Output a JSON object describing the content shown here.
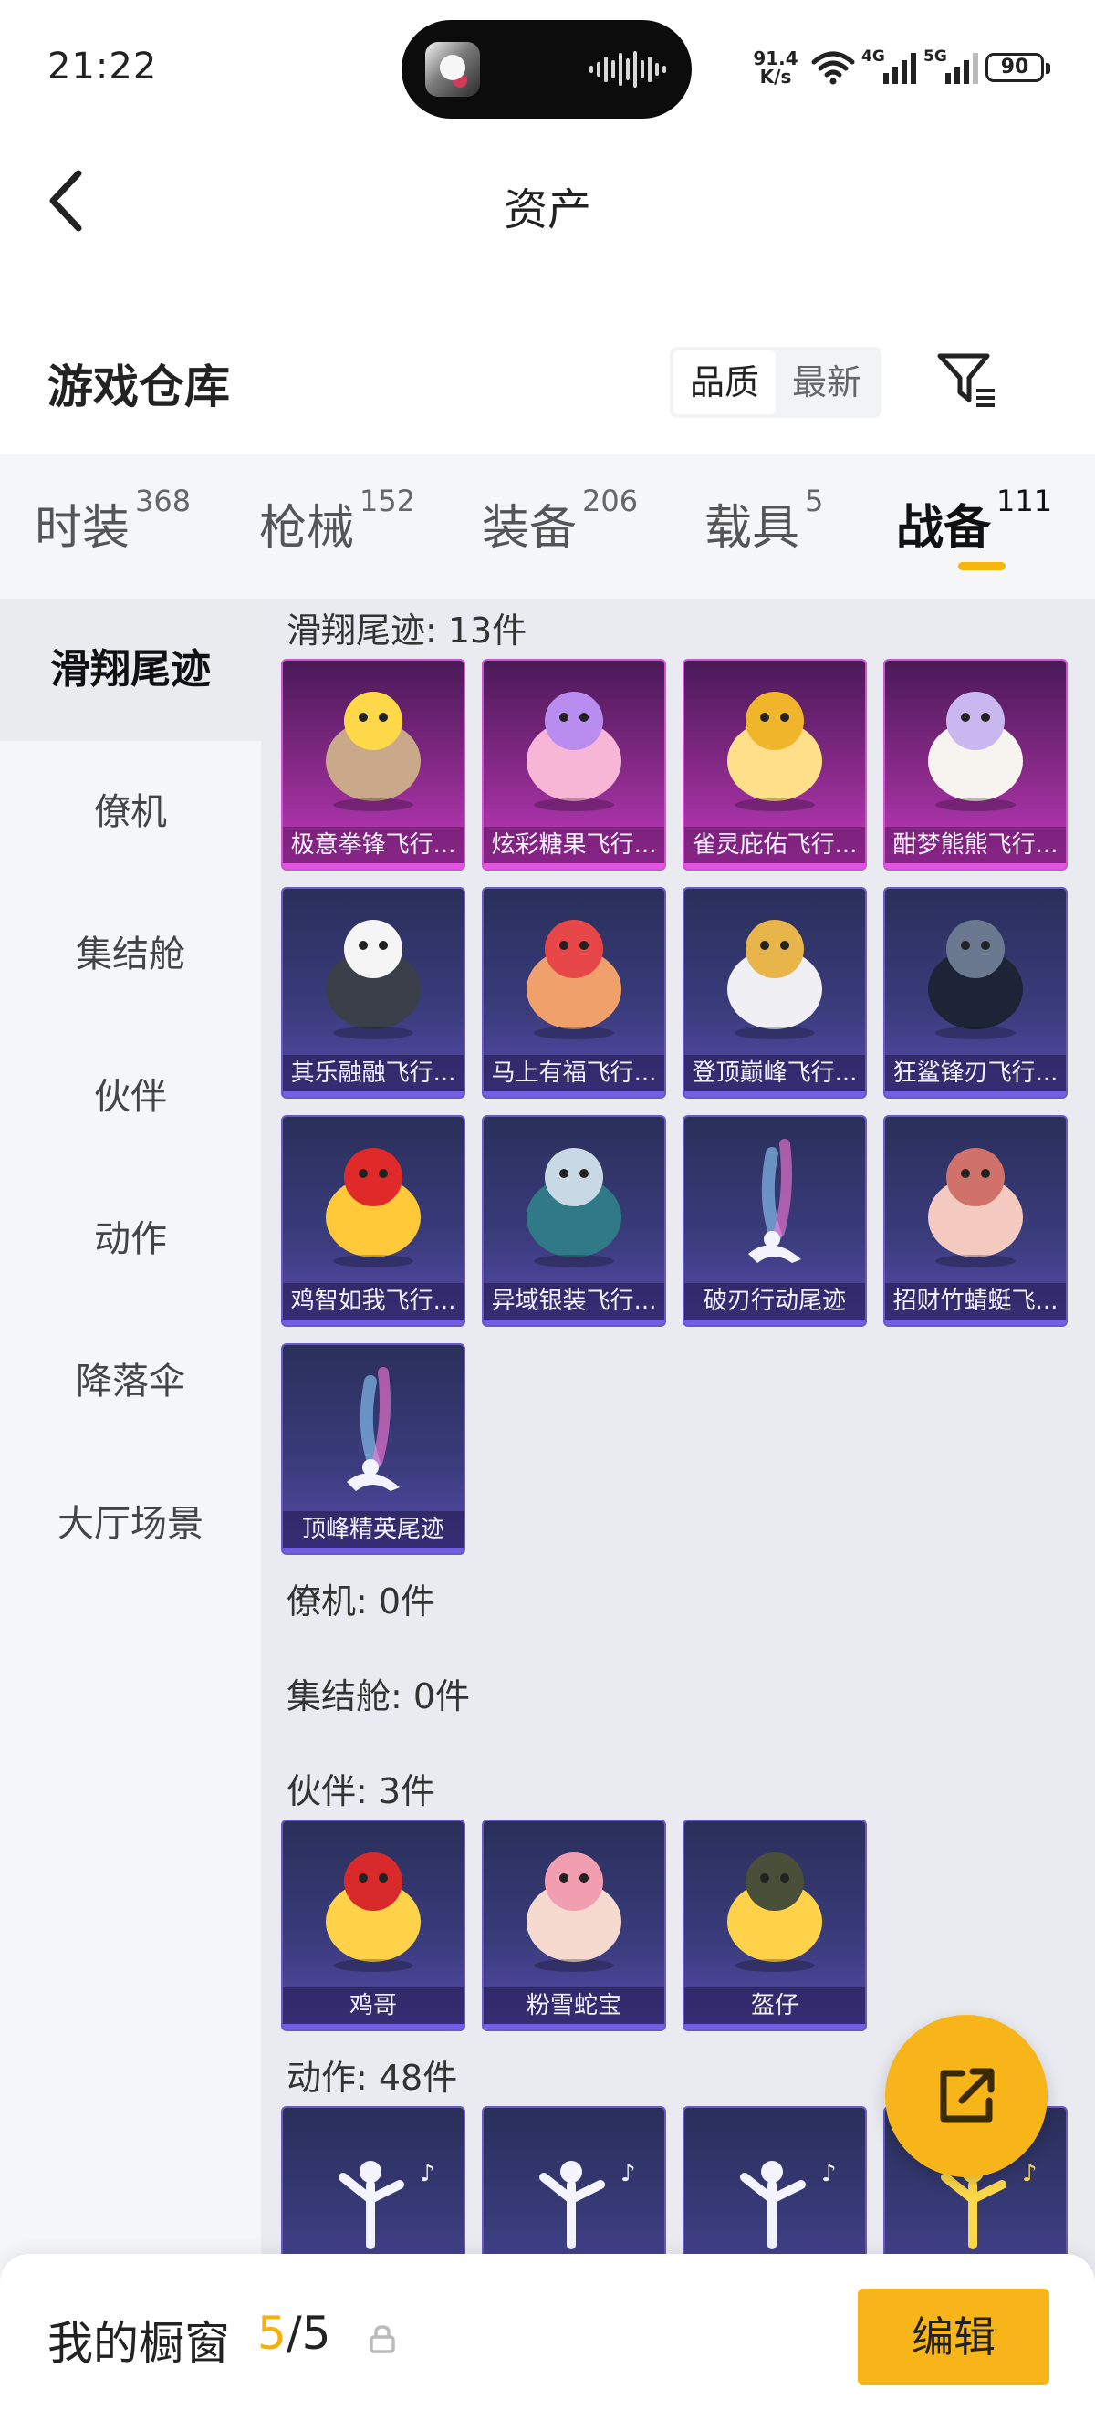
{
  "status_bar": {
    "time": "21:22",
    "net_speed_value": "91.4",
    "net_speed_unit": "K/s",
    "sim1_label": "4G",
    "sim2_label": "5G",
    "battery": "90"
  },
  "header": {
    "title": "资产"
  },
  "warehouse": {
    "title": "游戏仓库",
    "sort_options": [
      "品质",
      "最新"
    ],
    "sort_selected": "品质"
  },
  "tabs": [
    {
      "label": "时装",
      "count": "368"
    },
    {
      "label": "枪械",
      "count": "152"
    },
    {
      "label": "装备",
      "count": "206"
    },
    {
      "label": "载具",
      "count": "5"
    },
    {
      "label": "战备",
      "count": "111"
    }
  ],
  "active_tab": "战备",
  "sidebar": {
    "items": [
      "滑翔尾迹",
      "僚机",
      "集结舱",
      "伙伴",
      "动作",
      "降落伞",
      "大厅场景"
    ],
    "selected": "滑翔尾迹"
  },
  "groups": [
    {
      "title": "滑翔尾迹: 13件",
      "items": [
        {
          "name": "极意拳锋飞行...",
          "quality": "purple",
          "icon": "boxing-elephant-icon"
        },
        {
          "name": "炫彩糖果飞行...",
          "quality": "purple",
          "icon": "candy-icon"
        },
        {
          "name": "雀灵庇佑飞行...",
          "quality": "purple",
          "icon": "golden-bird-icon"
        },
        {
          "name": "酣梦熊熊飞行...",
          "quality": "purple",
          "icon": "sleepy-bear-icon"
        },
        {
          "name": "其乐融融飞行...",
          "quality": "blue",
          "icon": "penguin-icon"
        },
        {
          "name": "马上有福飞行...",
          "quality": "blue",
          "icon": "horse-icon"
        },
        {
          "name": "登顶巅峰飞行...",
          "quality": "blue",
          "icon": "jet-icon"
        },
        {
          "name": "狂鲨锋刃飞行...",
          "quality": "blue",
          "icon": "shark-icon"
        },
        {
          "name": "鸡智如我飞行...",
          "quality": "blue",
          "icon": "chicken-icon"
        },
        {
          "name": "异域银装飞行...",
          "quality": "blue",
          "icon": "wings-icon"
        },
        {
          "name": "破刃行动尾迹",
          "quality": "blue",
          "icon": "smoke-trail-icon"
        },
        {
          "name": "招财竹蜻蜓飞...",
          "quality": "blue",
          "icon": "propeller-cat-icon"
        },
        {
          "name": "顶峰精英尾迹",
          "quality": "blue",
          "icon": "smoke-trail-icon"
        }
      ]
    },
    {
      "title": "僚机: 0件",
      "items": []
    },
    {
      "title": "集结舱: 0件",
      "items": []
    },
    {
      "title": "伙伴: 3件",
      "items": [
        {
          "name": "鸡哥",
          "quality": "blue",
          "icon": "chicken-sunglasses-icon"
        },
        {
          "name": "粉雪蛇宝",
          "quality": "blue",
          "icon": "snake-doll-icon"
        },
        {
          "name": "盔仔",
          "quality": "blue",
          "icon": "helmet-chick-icon"
        }
      ]
    },
    {
      "title": "动作: 48件",
      "items": [
        {
          "name": "",
          "quality": "blue",
          "icon": "dance-icon"
        },
        {
          "name": "",
          "quality": "blue",
          "icon": "dance-icon"
        },
        {
          "name": "",
          "quality": "blue",
          "icon": "dance-icon"
        },
        {
          "name": "",
          "quality": "gold",
          "icon": "golden-dance-icon"
        }
      ]
    }
  ],
  "bottom_bar": {
    "label": "我的橱窗",
    "current": "5",
    "separator": "/",
    "total": "5",
    "edit_label": "编辑"
  },
  "colors": {
    "accent": "#f8b51a",
    "purple_quality": "#c23bc0",
    "blue_quality": "#5a4bb0"
  }
}
